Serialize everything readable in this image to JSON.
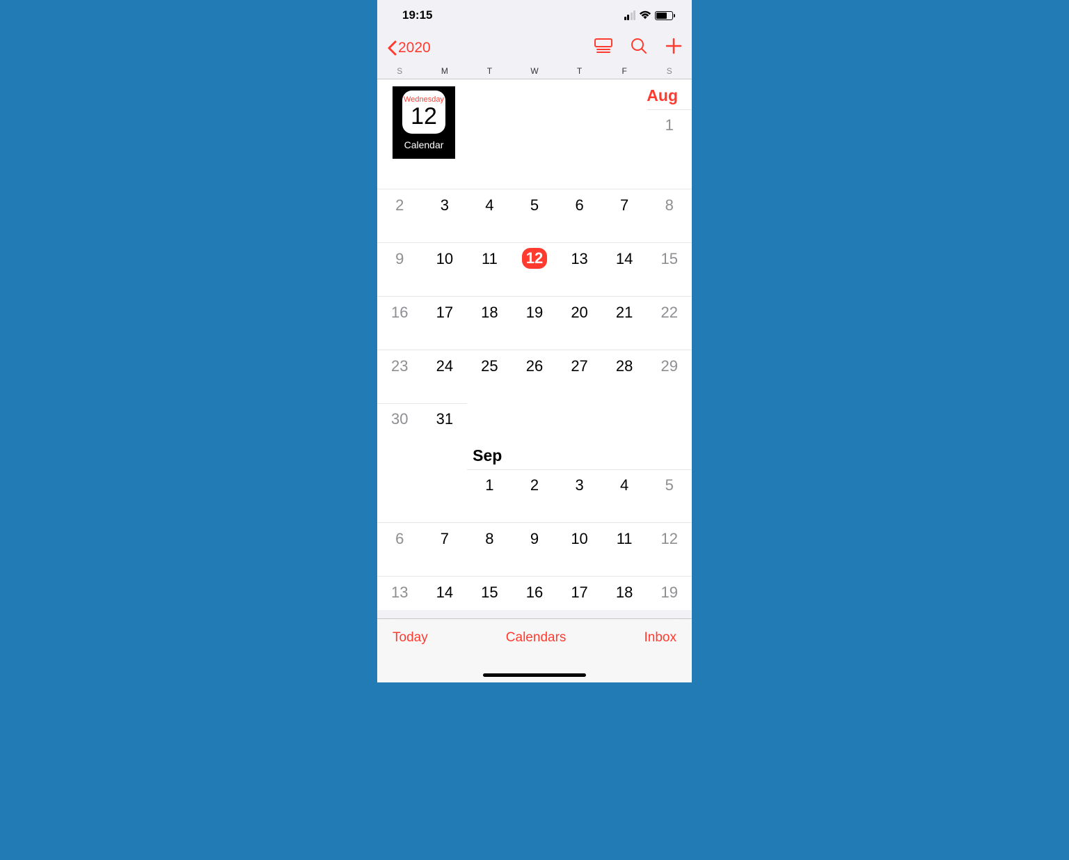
{
  "status": {
    "time": "19:15"
  },
  "nav": {
    "back_label": "2020"
  },
  "weekdays": [
    "S",
    "M",
    "T",
    "W",
    "T",
    "F",
    "S"
  ],
  "app_overlay": {
    "weekday": "Wednesday",
    "day": "12",
    "label": "Calendar"
  },
  "months": {
    "aug": {
      "label": "Aug",
      "weeks": [
        [
          "",
          "",
          "",
          "",
          "",
          "",
          "1"
        ],
        [
          "2",
          "3",
          "4",
          "5",
          "6",
          "7",
          "8"
        ],
        [
          "9",
          "10",
          "11",
          "12",
          "13",
          "14",
          "15"
        ],
        [
          "16",
          "17",
          "18",
          "19",
          "20",
          "21",
          "22"
        ],
        [
          "23",
          "24",
          "25",
          "26",
          "27",
          "28",
          "29"
        ],
        [
          "30",
          "31",
          "",
          "",
          "",
          "",
          ""
        ]
      ],
      "today": "12"
    },
    "sep": {
      "label": "Sep",
      "weeks": [
        [
          "",
          "",
          "1",
          "2",
          "3",
          "4",
          "5"
        ],
        [
          "6",
          "7",
          "8",
          "9",
          "10",
          "11",
          "12"
        ],
        [
          "13",
          "14",
          "15",
          "16",
          "17",
          "18",
          "19"
        ]
      ]
    }
  },
  "bottom": {
    "today": "Today",
    "calendars": "Calendars",
    "inbox": "Inbox"
  }
}
